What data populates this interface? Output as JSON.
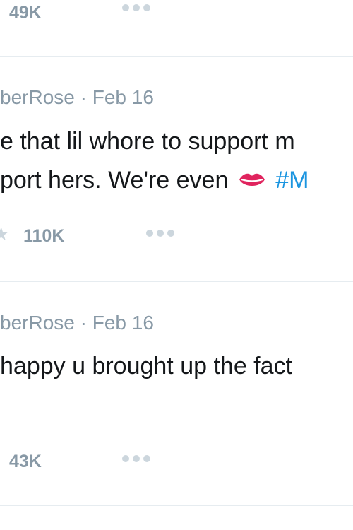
{
  "tweets": [
    {
      "like_count": "49K"
    },
    {
      "author_partial": "berRose",
      "separator": "·",
      "date": "Feb 16",
      "line1": "e that lil whore to support m",
      "line2": "port hers. We're even",
      "hashtag": "#M",
      "like_count": "110K"
    },
    {
      "author_partial": "berRose",
      "separator": "·",
      "date": "Feb 16",
      "line1": "happy u brought up the fact",
      "like_count": "43K"
    }
  ],
  "icons": {
    "more": "more-icon",
    "star": "star-icon",
    "lips": "kiss-lips-emoji"
  },
  "colors": {
    "text": "#14171a",
    "meta": "#8899a6",
    "hashtag": "#1b95e0",
    "divider": "#e6ecf0"
  }
}
